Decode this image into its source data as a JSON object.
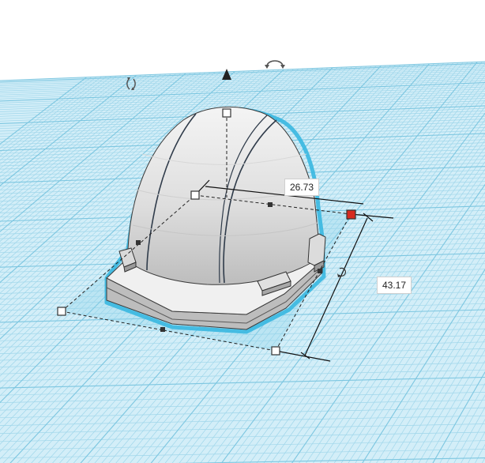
{
  "scene": {
    "grid_color": "#9fd6ea",
    "grid_bg": "#d3eef8",
    "selection_color": "#38b7e0",
    "object_color": "#e3e3e3",
    "active_handle_color": "#d62b20"
  },
  "dimensions": {
    "width": "26.73",
    "depth": "43.17"
  },
  "controls": {
    "rotate_left_icon": "rotate-arrow-icon",
    "lift_icon": "lift-cone-icon",
    "rotate_top_icon": "rotate-arrow-icon"
  }
}
